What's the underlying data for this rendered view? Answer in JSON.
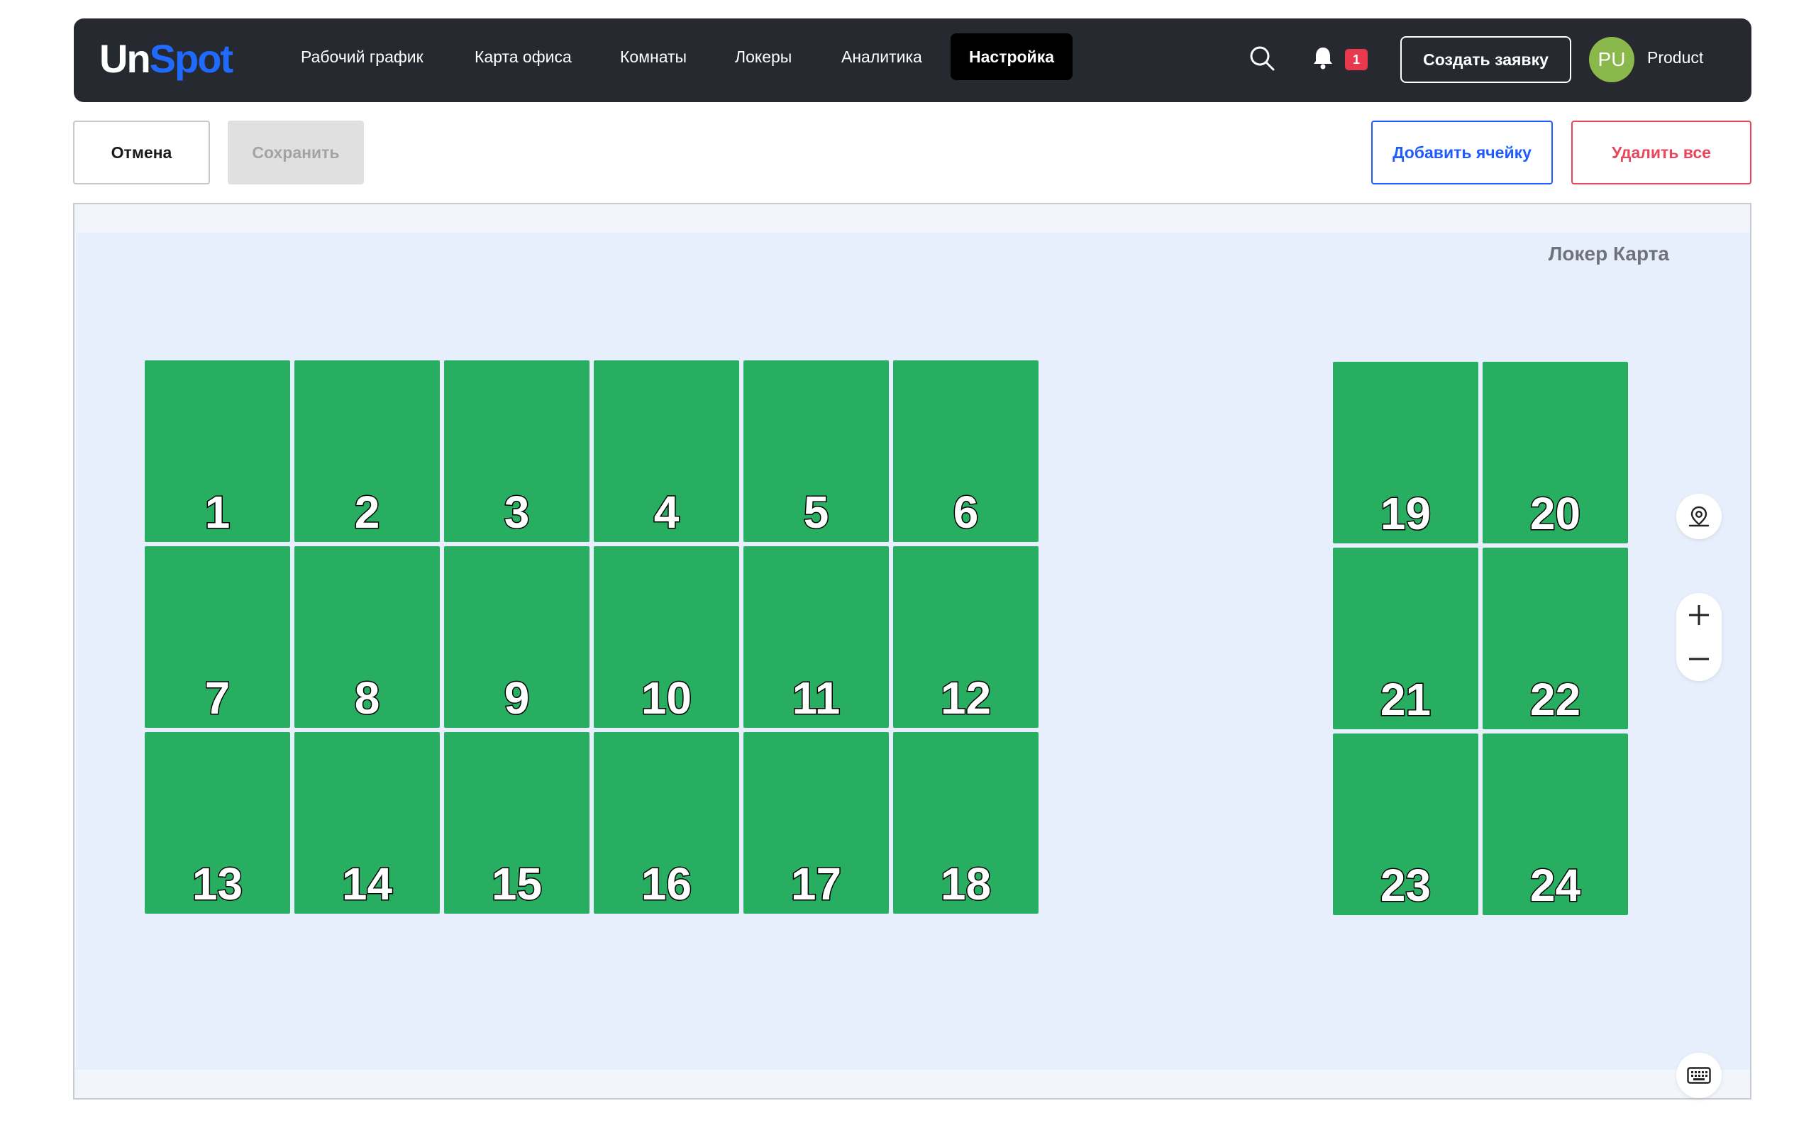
{
  "brand": {
    "logo_part1": "Un",
    "logo_part2": "Spot"
  },
  "nav": {
    "items": [
      {
        "label": "Рабочий график"
      },
      {
        "label": "Карта офиса"
      },
      {
        "label": "Комнаты"
      },
      {
        "label": "Локеры"
      },
      {
        "label": "Аналитика"
      },
      {
        "label": "Настройка",
        "active": true
      }
    ]
  },
  "header": {
    "search_icon": "search-icon",
    "bell_icon": "bell-icon",
    "notification_count": "1",
    "create_label": "Создать заявку",
    "avatar_initials": "PU",
    "user_name": "Product"
  },
  "toolbar": {
    "cancel_label": "Отмена",
    "save_label": "Сохранить",
    "add_cell_label": "Добавить ячейку",
    "delete_all_label": "Удалить все"
  },
  "map": {
    "title": "Локер Карта",
    "cell_color": "#28ae60",
    "block_left": [
      "1",
      "2",
      "3",
      "4",
      "5",
      "6",
      "7",
      "8",
      "9",
      "10",
      "11",
      "12",
      "13",
      "14",
      "15",
      "16",
      "17",
      "18"
    ],
    "block_right": [
      "19",
      "20",
      "21",
      "22",
      "23",
      "24"
    ],
    "controls": [
      "location-pin-icon",
      "zoom-in-icon",
      "zoom-out-icon",
      "keyboard-icon"
    ]
  },
  "colors": {
    "header_bg": "#262930",
    "accent_blue": "#1f5cff",
    "danger_red": "#e8465c",
    "canvas_bg": "#e8effc"
  }
}
